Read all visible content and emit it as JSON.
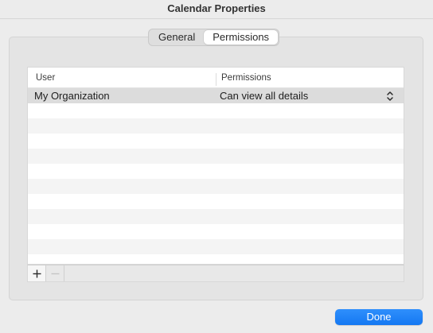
{
  "window": {
    "title": "Calendar Properties"
  },
  "tabs": [
    {
      "label": "General",
      "active": false
    },
    {
      "label": "Permissions",
      "active": true
    }
  ],
  "table": {
    "columns": [
      "User",
      "Permissions"
    ],
    "rows": [
      {
        "user": "My Organization",
        "permission": "Can view all details",
        "selected": true
      }
    ]
  },
  "toolbar": {
    "add_label": "+",
    "remove_label": "−"
  },
  "buttons": {
    "done_label": "Done"
  },
  "colors": {
    "accent": "#1a82fb",
    "selected_row": "#dcdcdc",
    "window_bg": "#ececec"
  }
}
